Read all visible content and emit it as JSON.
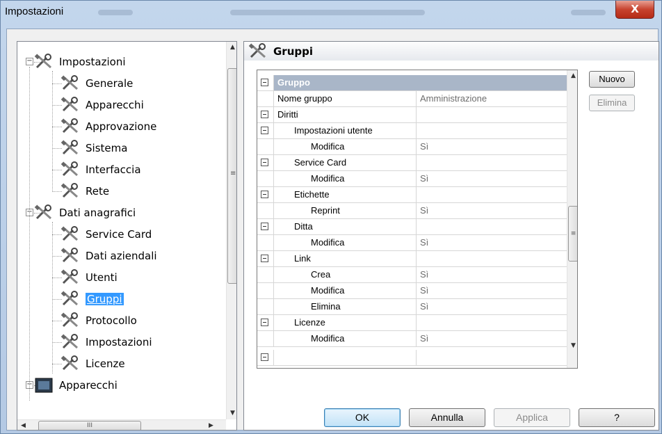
{
  "window": {
    "title": "Impostazioni",
    "close_label": "X"
  },
  "tree": {
    "nodes": [
      {
        "label": "Impostazioni",
        "expanded": true,
        "level": 0
      },
      {
        "label": "Generale",
        "level": 1
      },
      {
        "label": "Apparecchi",
        "level": 1
      },
      {
        "label": "Approvazione",
        "level": 1
      },
      {
        "label": "Sistema",
        "level": 1
      },
      {
        "label": "Interfaccia",
        "level": 1
      },
      {
        "label": "Rete",
        "level": 1
      },
      {
        "label": "Dati anagrafici",
        "expanded": true,
        "level": 0
      },
      {
        "label": "Service Card",
        "level": 1
      },
      {
        "label": "Dati aziendali",
        "level": 1
      },
      {
        "label": "Utenti",
        "level": 1
      },
      {
        "label": "Gruppi",
        "level": 1,
        "selected": true
      },
      {
        "label": "Protocollo",
        "level": 1
      },
      {
        "label": "Impostazioni",
        "level": 1
      },
      {
        "label": "Licenze",
        "level": 1
      },
      {
        "label": "Apparecchi",
        "expanded": true,
        "level": 0
      }
    ],
    "hscroll_thumb_label": "III",
    "vscroll_thumb_label": "≡"
  },
  "panel": {
    "title": "Gruppi",
    "grid": {
      "rows": [
        {
          "name": "Gruppo",
          "value": "",
          "type": "group",
          "expander": true
        },
        {
          "name": "Nome gruppo",
          "value": "Amministrazione",
          "indent": 0
        },
        {
          "name": "Diritti",
          "value": "",
          "indent": 0,
          "expander": true
        },
        {
          "name": "Impostazioni utente",
          "value": "",
          "indent": 1,
          "expander": true
        },
        {
          "name": "Modifica",
          "value": "Sì",
          "indent": 2
        },
        {
          "name": "Service Card",
          "value": "",
          "indent": 1,
          "expander": true
        },
        {
          "name": "Modifica",
          "value": "Sì",
          "indent": 2
        },
        {
          "name": "Etichette",
          "value": "",
          "indent": 1,
          "expander": true
        },
        {
          "name": "Reprint",
          "value": "Sì",
          "indent": 2
        },
        {
          "name": "Ditta",
          "value": "",
          "indent": 1,
          "expander": true
        },
        {
          "name": "Modifica",
          "value": "Sì",
          "indent": 2
        },
        {
          "name": "Link",
          "value": "",
          "indent": 1,
          "expander": true
        },
        {
          "name": "Crea",
          "value": "Sì",
          "indent": 2
        },
        {
          "name": "Modifica",
          "value": "Sì",
          "indent": 2
        },
        {
          "name": "Elimina",
          "value": "Sì",
          "indent": 2
        },
        {
          "name": "Licenze",
          "value": "",
          "indent": 1,
          "expander": true
        },
        {
          "name": "Modifica",
          "value": "Sì",
          "indent": 2
        }
      ],
      "scroll_thumb_label": "≡"
    },
    "buttons": {
      "new_label": "Nuovo",
      "delete_label": "Elimina"
    }
  },
  "footer": {
    "ok_label": "OK",
    "cancel_label": "Annulla",
    "apply_label": "Applica",
    "help_label": "?"
  },
  "colors": {
    "selection": "#3399ff",
    "group_row": "#a9b6c8",
    "titlebar": "#c3d6ec"
  }
}
